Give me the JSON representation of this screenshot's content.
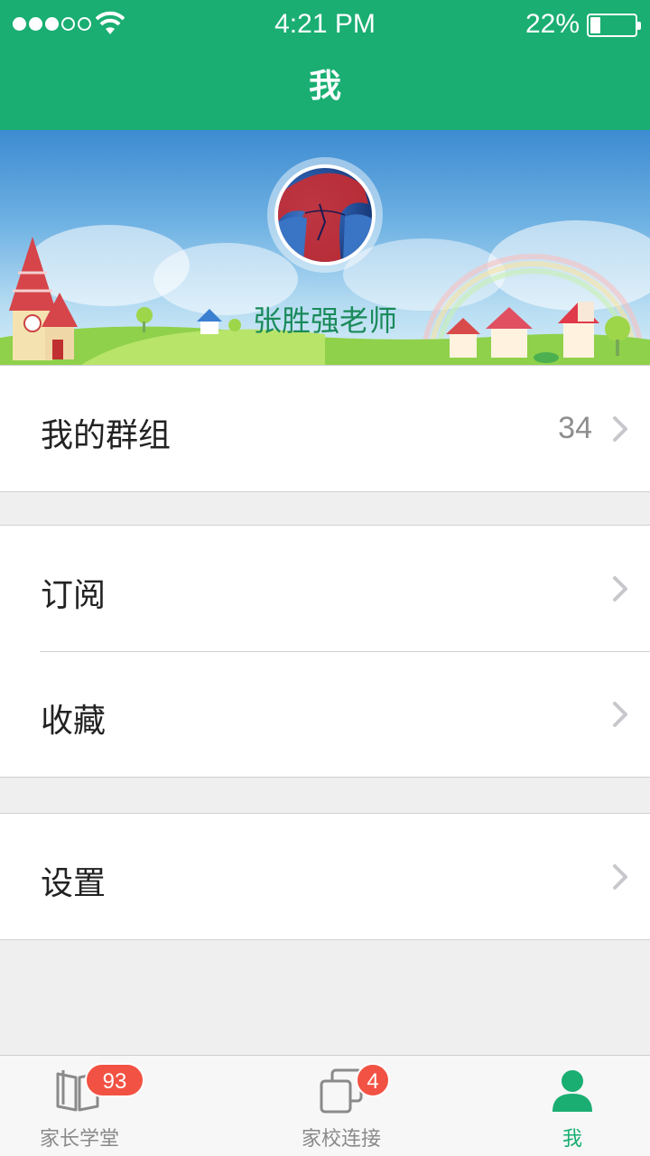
{
  "status_bar": {
    "time": "4:21 PM",
    "battery_percent": "22%",
    "battery_level": 0.22,
    "signal_bars_filled": 3,
    "signal_bars_total": 5
  },
  "nav": {
    "title": "我"
  },
  "profile": {
    "username": "张胜强老师"
  },
  "menu": {
    "groups": {
      "label": "我的群组",
      "count": "34"
    },
    "subscribe": {
      "label": "订阅"
    },
    "favorites": {
      "label": "收藏"
    },
    "settings": {
      "label": "设置"
    }
  },
  "tabbar": {
    "tabs": [
      {
        "label": "家长学堂",
        "badge": "93",
        "icon": "book-icon"
      },
      {
        "label": "家校连接",
        "badge": "4",
        "icon": "windows-icon"
      },
      {
        "label": "我",
        "icon": "person-icon",
        "active": true
      }
    ]
  },
  "colors": {
    "primary": "#1aae72",
    "badge": "#f25243",
    "background": "#efefef"
  }
}
